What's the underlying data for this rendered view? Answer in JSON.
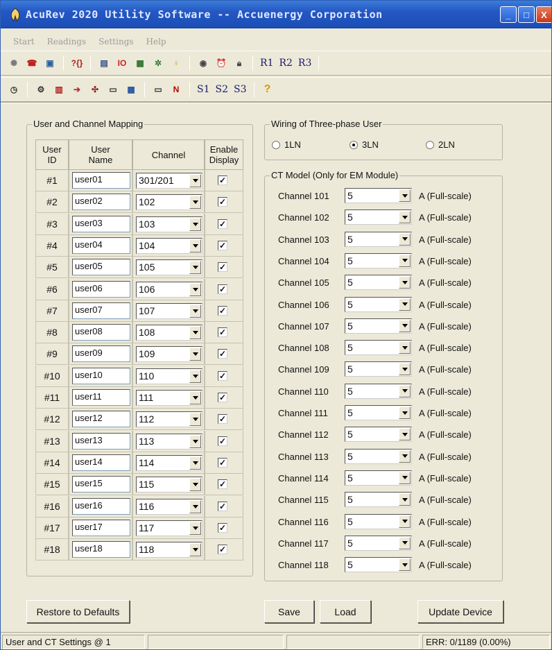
{
  "window": {
    "title": "AcuRev 2020 Utility Software -- Accuenergy Corporation",
    "controls": {
      "minimize": "_",
      "maximize": "□",
      "close": "X"
    }
  },
  "menu": [
    "Start",
    "Readings",
    "Settings",
    "Help"
  ],
  "toolbar1": {
    "icons": [
      "exit-icon",
      "phone-icon",
      "monitor-icon",
      "question-bracket-icon",
      "display-icon",
      "io-icon",
      "grid-icon",
      "gear-bug-icon",
      "bulb-icon",
      "target-icon",
      "alarm-clock-icon",
      "lock-icon"
    ],
    "text_buttons": [
      "R1",
      "R2",
      "R3"
    ]
  },
  "toolbar2": {
    "icons": [
      "clock-icon",
      "settings-gear-icon",
      "export-icon",
      "forward-icon",
      "flow-icon",
      "document-e-icon",
      "table-icon",
      "document-n-icon",
      "n-icon"
    ],
    "text_buttons": [
      "S1",
      "S2",
      "S3"
    ],
    "help_icon": "?"
  },
  "user_mapping": {
    "title": "User and Channel Mapping",
    "headers": {
      "id": "User ID",
      "name": "User Name",
      "channel": "Channel",
      "enable": "Enable Display"
    },
    "rows": [
      {
        "id": "#1",
        "name": "user01",
        "channel": "301/201",
        "enabled": true
      },
      {
        "id": "#2",
        "name": "user02",
        "channel": "102",
        "enabled": true
      },
      {
        "id": "#3",
        "name": "user03",
        "channel": "103",
        "enabled": true
      },
      {
        "id": "#4",
        "name": "user04",
        "channel": "104",
        "enabled": true
      },
      {
        "id": "#5",
        "name": "user05",
        "channel": "105",
        "enabled": true
      },
      {
        "id": "#6",
        "name": "user06",
        "channel": "106",
        "enabled": true
      },
      {
        "id": "#7",
        "name": "user07",
        "channel": "107",
        "enabled": true
      },
      {
        "id": "#8",
        "name": "user08",
        "channel": "108",
        "enabled": true
      },
      {
        "id": "#9",
        "name": "user09",
        "channel": "109",
        "enabled": true
      },
      {
        "id": "#10",
        "name": "user10",
        "channel": "110",
        "enabled": true
      },
      {
        "id": "#11",
        "name": "user11",
        "channel": "111",
        "enabled": true
      },
      {
        "id": "#12",
        "name": "user12",
        "channel": "112",
        "enabled": true
      },
      {
        "id": "#13",
        "name": "user13",
        "channel": "113",
        "enabled": true
      },
      {
        "id": "#14",
        "name": "user14",
        "channel": "114",
        "enabled": true
      },
      {
        "id": "#15",
        "name": "user15",
        "channel": "115",
        "enabled": true
      },
      {
        "id": "#16",
        "name": "user16",
        "channel": "116",
        "enabled": true
      },
      {
        "id": "#17",
        "name": "user17",
        "channel": "117",
        "enabled": true
      },
      {
        "id": "#18",
        "name": "user18",
        "channel": "118",
        "enabled": true
      }
    ]
  },
  "wiring": {
    "title": "Wiring of Three-phase User",
    "options": [
      {
        "label": "1LN",
        "selected": false
      },
      {
        "label": "3LN",
        "selected": true
      },
      {
        "label": "2LN",
        "selected": false
      }
    ]
  },
  "ct_model": {
    "title": "CT Model (Only for EM Module)",
    "unit": "A (Full-scale)",
    "rows": [
      {
        "label": "Channel 101",
        "value": "5"
      },
      {
        "label": "Channel 102",
        "value": "5"
      },
      {
        "label": "Channel 103",
        "value": "5"
      },
      {
        "label": "Channel 104",
        "value": "5"
      },
      {
        "label": "Channel 105",
        "value": "5"
      },
      {
        "label": "Channel 106",
        "value": "5"
      },
      {
        "label": "Channel 107",
        "value": "5"
      },
      {
        "label": "Channel 108",
        "value": "5"
      },
      {
        "label": "Channel 109",
        "value": "5"
      },
      {
        "label": "Channel 110",
        "value": "5"
      },
      {
        "label": "Channel 111",
        "value": "5"
      },
      {
        "label": "Channel 112",
        "value": "5"
      },
      {
        "label": "Channel 113",
        "value": "5"
      },
      {
        "label": "Channel 114",
        "value": "5"
      },
      {
        "label": "Channel 115",
        "value": "5"
      },
      {
        "label": "Channel 116",
        "value": "5"
      },
      {
        "label": "Channel 117",
        "value": "5"
      },
      {
        "label": "Channel 118",
        "value": "5"
      }
    ]
  },
  "buttons": {
    "restore": "Restore to Defaults",
    "save": "Save",
    "load": "Load",
    "update": "Update Device"
  },
  "status": {
    "left": "User and CT Settings @ 1",
    "right": "ERR: 0/1189 (0.00%)"
  },
  "colors": {
    "titlebar": "#2457c4",
    "window_bg": "#ece9d8",
    "field_border": "#7f9db9"
  }
}
